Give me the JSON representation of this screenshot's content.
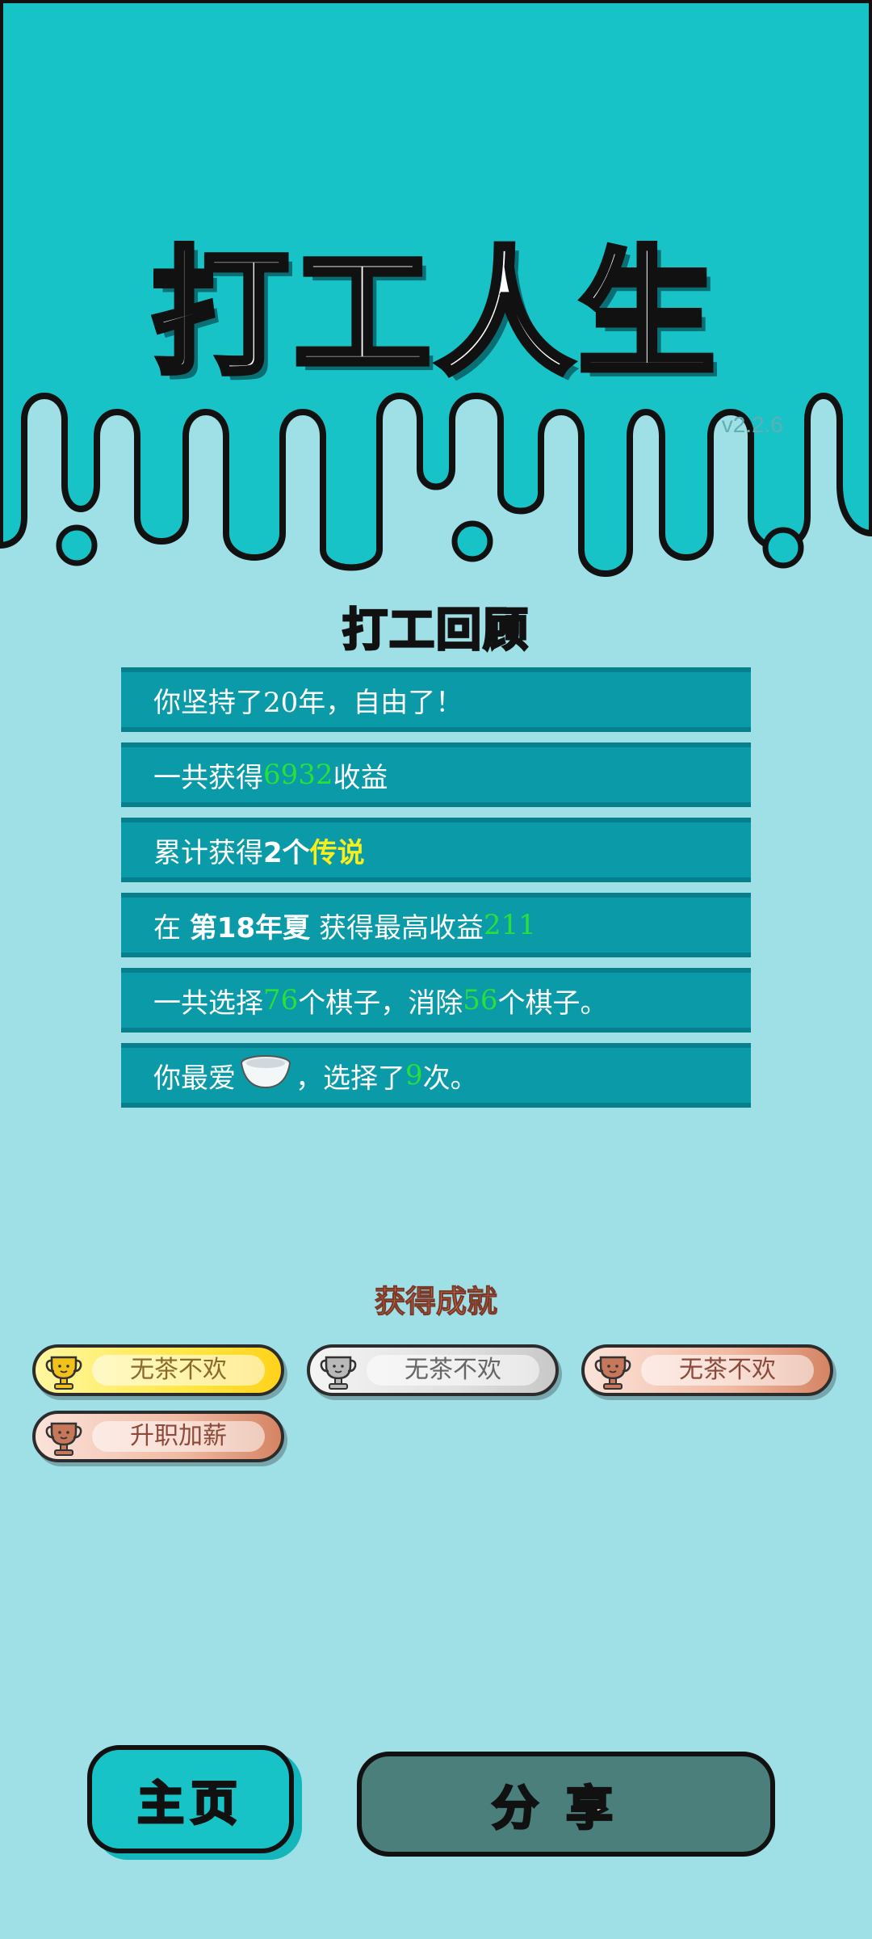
{
  "game": {
    "title": "打工人生",
    "version": "v2.2.6"
  },
  "review": {
    "title": "打工回顾",
    "rows": [
      {
        "parts": [
          {
            "t": "你坚持了20年，自由了！",
            "s": ""
          }
        ]
      },
      {
        "parts": [
          {
            "t": "一共获得",
            "s": ""
          },
          {
            "t": "6932",
            "s": "green"
          },
          {
            "t": "收益",
            "s": ""
          }
        ]
      },
      {
        "parts": [
          {
            "t": "累计获得",
            "s": ""
          },
          {
            "t": "2个",
            "s": "bold"
          },
          {
            "t": "传说",
            "s": "yellow"
          }
        ]
      },
      {
        "parts": [
          {
            "t": "在 ",
            "s": ""
          },
          {
            "t": "第18年夏",
            "s": "bold"
          },
          {
            "t": " 获得最高收益",
            "s": ""
          },
          {
            "t": "211",
            "s": "green"
          }
        ]
      },
      {
        "parts": [
          {
            "t": "一共选择",
            "s": ""
          },
          {
            "t": "76",
            "s": "green"
          },
          {
            "t": "个棋子，消除",
            "s": ""
          },
          {
            "t": "56",
            "s": "green"
          },
          {
            "t": "个棋子。",
            "s": ""
          }
        ]
      },
      {
        "parts": [
          {
            "t": "你最爱",
            "s": ""
          },
          {
            "t": "bowl-icon",
            "s": "icon"
          },
          {
            "t": "，选择了",
            "s": ""
          },
          {
            "t": "9",
            "s": "green"
          },
          {
            "t": "次。",
            "s": ""
          }
        ]
      }
    ]
  },
  "achievements": {
    "title": "获得成就",
    "items": [
      {
        "label": "无茶不欢",
        "tier": "gold"
      },
      {
        "label": "无茶不欢",
        "tier": "silver"
      },
      {
        "label": "无茶不欢",
        "tier": "bronze"
      },
      {
        "label": "升职加薪",
        "tier": "bronze"
      }
    ]
  },
  "buttons": {
    "home": "主页",
    "share": "分享"
  },
  "colors": {
    "teal": "#17c3c6",
    "background": "#9fdfe6",
    "row": "#0b9aa8",
    "highlight_green": "#27e03a",
    "highlight_yellow": "#f7ee1f"
  }
}
